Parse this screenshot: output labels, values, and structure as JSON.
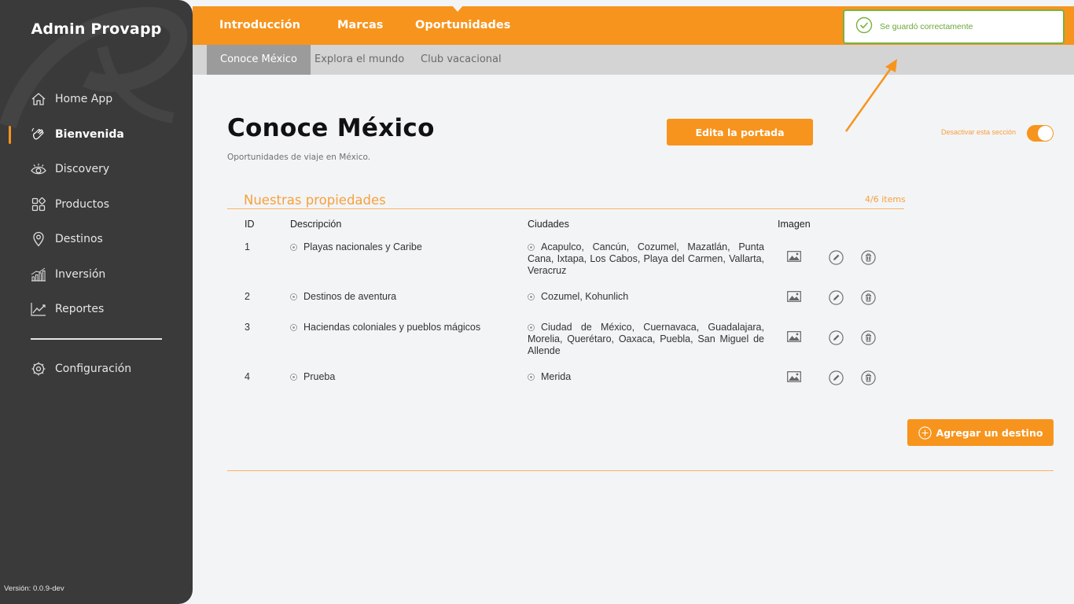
{
  "sidebar": {
    "brand": "Admin Provapp",
    "items": [
      {
        "label": "Home App",
        "icon": "home-icon"
      },
      {
        "label": "Bienvenida",
        "icon": "waving-hand-icon",
        "active": true
      },
      {
        "label": "Discovery",
        "icon": "eye-icon"
      },
      {
        "label": "Productos",
        "icon": "grid-icon"
      },
      {
        "label": "Destinos",
        "icon": "map-pin-icon"
      },
      {
        "label": "Inversión",
        "icon": "bar-chart-icon"
      },
      {
        "label": "Reportes",
        "icon": "line-chart-icon"
      }
    ],
    "config": {
      "label": "Configuración",
      "icon": "gear-icon"
    },
    "version": "Versión: 0.0.9-dev"
  },
  "topnav": {
    "tabs": [
      "Introducción",
      "Marcas",
      "Oportunidades"
    ],
    "active_tab": "Oportunidades"
  },
  "subnav": {
    "tabs": [
      "Conoce México",
      "Explora el mundo",
      "Club vacacional"
    ],
    "active_tab": "Conoce México"
  },
  "toast": {
    "text": "Se guardó correctamente",
    "color": "#7ab23f"
  },
  "page": {
    "title": "Conoce México",
    "subtitle": "Oportunidades de viaje en México.",
    "edit_button": "Edita la portada",
    "toggle_label": "Desactivar esta sección",
    "toggle_on": true
  },
  "section": {
    "title": "Nuestras propiedades",
    "count": "4/6 items",
    "headers": {
      "id": "ID",
      "description": "Descripción",
      "cities": "Ciudades",
      "image": "Imagen"
    },
    "rows": [
      {
        "id": "1",
        "description": "Playas nacionales y Caribe",
        "cities": "Acapulco, Cancún, Cozumel, Mazatlán, Punta Cana, Ixtapa, Los Cabos, Playa del Carmen, Vallarta, Veracruz"
      },
      {
        "id": "2",
        "description": "Destinos de aventura",
        "cities": "Cozumel, Kohunlich"
      },
      {
        "id": "3",
        "description": "Haciendas coloniales y pueblos mágicos",
        "cities": "Ciudad de México, Cuernavaca, Guadalajara, Morelia, Querétaro, Oaxaca, Puebla, San Miguel de Allende"
      },
      {
        "id": "4",
        "description": "Prueba",
        "cities": "Merida"
      }
    ],
    "add_button": "Agregar un destino"
  },
  "colors": {
    "accent": "#f7941d",
    "sidebar": "#3a3a3a",
    "success": "#7ab23f"
  }
}
